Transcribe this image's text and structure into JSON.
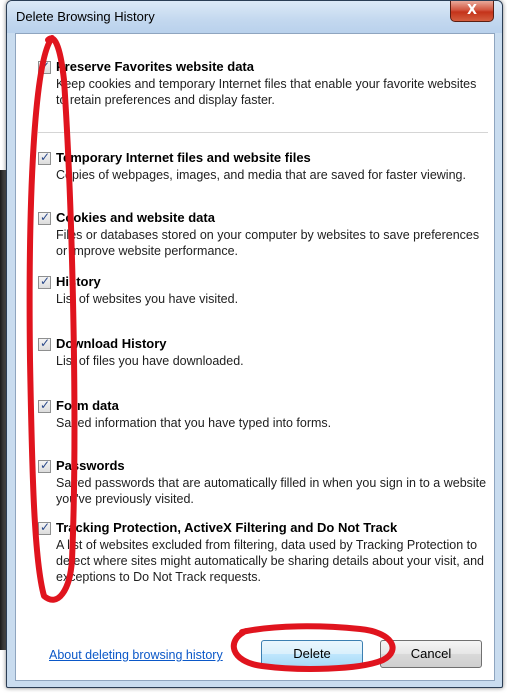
{
  "window": {
    "title": "Delete Browsing History",
    "close_glyph": "X"
  },
  "options": [
    {
      "checked": true,
      "title": "Preserve Favorites website data",
      "description": "Keep cookies and temporary Internet files that enable your favorite websites to retain preferences and display faster."
    },
    {
      "checked": true,
      "title": "Temporary Internet files and website files",
      "description": "Copies of webpages, images, and media that are saved for faster viewing."
    },
    {
      "checked": true,
      "title": "Cookies and website data",
      "description": "Files or databases stored on your computer by websites to save preferences or improve website performance."
    },
    {
      "checked": true,
      "title": "History",
      "description": "List of websites you have visited."
    },
    {
      "checked": true,
      "title": "Download History",
      "description": "List of files you have downloaded."
    },
    {
      "checked": true,
      "title": "Form data",
      "description": "Saved information that you have typed into forms."
    },
    {
      "checked": true,
      "title": "Passwords",
      "description": "Saved passwords that are automatically filled in when you sign in to a website you've previously visited."
    },
    {
      "checked": true,
      "title": "Tracking Protection, ActiveX Filtering and Do Not Track",
      "description": "A list of websites excluded from filtering, data used by Tracking Protection to detect where sites might automatically be sharing details about your visit, and exceptions to Do Not Track requests."
    }
  ],
  "footer": {
    "help_link": "About deleting browsing history",
    "delete_label": "Delete",
    "cancel_label": "Cancel"
  },
  "check_glyph": "✓",
  "colors": {
    "annotation_red": "#e0141e",
    "link_blue": "#0b58c8",
    "close_red": "#c4331a"
  }
}
